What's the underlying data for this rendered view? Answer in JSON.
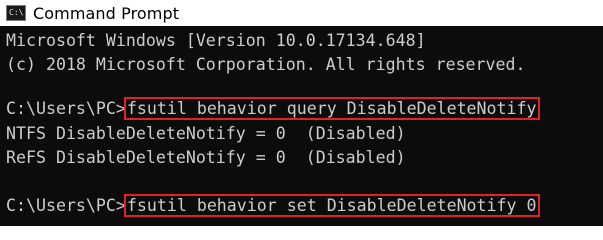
{
  "window": {
    "title": "Command Prompt",
    "icon": "C:\\"
  },
  "console": {
    "lines": [
      {
        "text": "Microsoft Windows [Version 10.0.17134.648]"
      },
      {
        "text": "(c) 2018 Microsoft Corporation. All rights reserved."
      },
      {
        "prompt": "C:\\Users\\PC>",
        "command": "fsutil behavior query DisableDeleteNotify"
      },
      {
        "text": "NTFS DisableDeleteNotify = 0  (Disabled)"
      },
      {
        "text": "ReFS DisableDeleteNotify = 0  (Disabled)"
      },
      {
        "prompt": "C:\\Users\\PC>",
        "command": "fsutil behavior set DisableDeleteNotify 0"
      }
    ]
  },
  "colors": {
    "background": "#0c0c0c",
    "text": "#cccccc",
    "highlight_border": "#e0202a",
    "titlebar": "#ffffff"
  }
}
